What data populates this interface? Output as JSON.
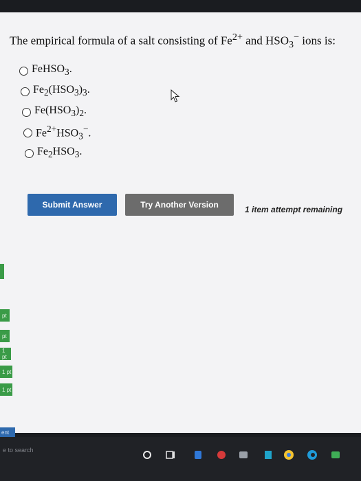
{
  "question": {
    "intro": "The empirical formula of a salt consisting of Fe",
    "ion1_charge": "2+",
    "conj": " and HSO",
    "ion2_sub": "3",
    "ion2_charge": "−",
    "tail": " ions is:"
  },
  "choices": [
    {
      "id": "a",
      "parts": [
        "FeHSO",
        "3",
        "."
      ]
    },
    {
      "id": "b",
      "parts": [
        "Fe",
        "2",
        "(HSO",
        "3",
        ")",
        "3",
        "."
      ]
    },
    {
      "id": "c",
      "parts": [
        "Fe(HSO",
        "3",
        ")",
        "2",
        "."
      ]
    },
    {
      "id": "d",
      "parts": [
        "Fe",
        "2+",
        "HSO",
        "3",
        "−",
        "."
      ]
    },
    {
      "id": "e",
      "parts": [
        "Fe",
        "2",
        "HSO",
        "3",
        "."
      ]
    }
  ],
  "buttons": {
    "submit": "Submit Answer",
    "try_another": "Try Another Version"
  },
  "attempts_text": "1 item attempt remaining",
  "side_nav": {
    "items": [
      "pt",
      "pt",
      "1 pt",
      "1 pt",
      "1 pt"
    ],
    "submit_label": "ent"
  },
  "taskbar": {
    "search_placeholder": "e to search"
  },
  "colors": {
    "submit": "#2e69ad",
    "try_another": "#6c6c6c",
    "side_tab": "#3a9b47"
  }
}
